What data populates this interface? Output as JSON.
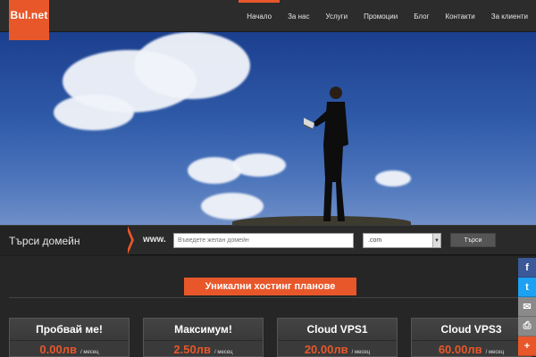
{
  "brand": {
    "logo_text": "Bul.net",
    "accent_color": "#e8572a"
  },
  "nav": {
    "items": [
      {
        "label": "Начало",
        "active": true
      },
      {
        "label": "За нас"
      },
      {
        "label": "Услуги"
      },
      {
        "label": "Промоции"
      },
      {
        "label": "Блог"
      },
      {
        "label": "Контакти"
      },
      {
        "label": "За клиенти"
      }
    ]
  },
  "hero": {
    "slides_count": 5,
    "active_slide": 1
  },
  "domain_search": {
    "title": "Търси домейн",
    "prefix": "www.",
    "placeholder": "Въведете желан домейн",
    "tld_selected": ".com",
    "button_label": "Търси"
  },
  "plans": {
    "section_title": "Уникални хостинг планове",
    "items": [
      {
        "name": "Пробвай ме!",
        "price": "0.00лв",
        "period": "/ месец"
      },
      {
        "name": "Максимум!",
        "price": "2.50лв",
        "period": "/ месец"
      },
      {
        "name": "Cloud VPS1",
        "price": "20.00лв",
        "period": "/ месец"
      },
      {
        "name": "Cloud VPS3",
        "price": "60.00лв",
        "period": "/ месец"
      }
    ]
  },
  "social": [
    {
      "icon": "facebook-icon",
      "glyph": "f",
      "color": "#3b5998"
    },
    {
      "icon": "twitter-icon",
      "glyph": "t",
      "color": "#1da1f2"
    },
    {
      "icon": "email-icon",
      "glyph": "✉",
      "color": "#8a8a8a"
    },
    {
      "icon": "print-icon",
      "glyph": "⎙",
      "color": "#8a8a8a"
    },
    {
      "icon": "share-plus-icon",
      "glyph": "+",
      "color": "#e8572a"
    }
  ]
}
